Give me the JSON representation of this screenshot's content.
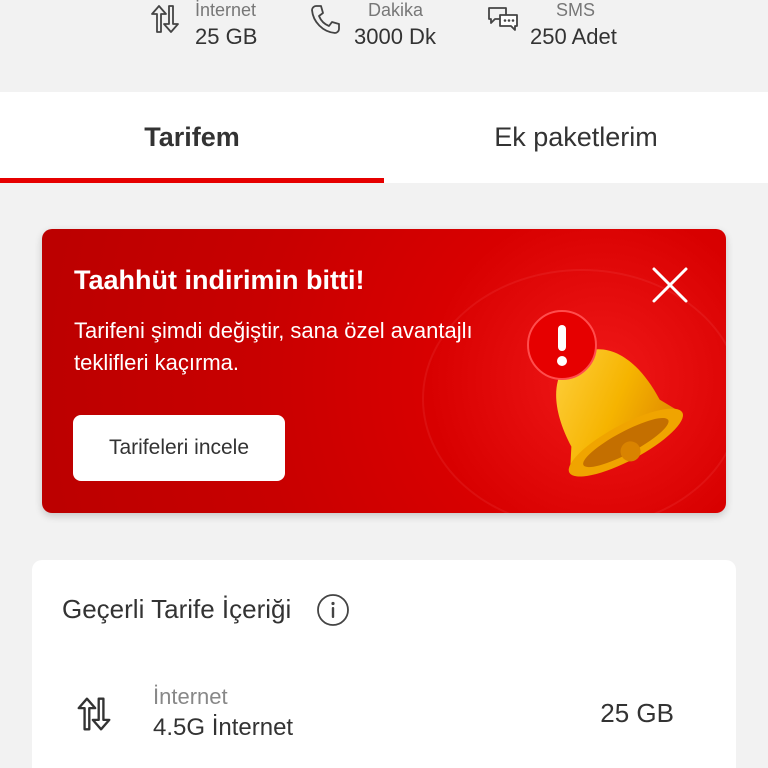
{
  "summary": {
    "internet": {
      "icon": "data-transfer-icon",
      "label": "İnternet",
      "value": "25 GB"
    },
    "minutes": {
      "icon": "phone-icon",
      "label": "Dakika",
      "value": "3000 Dk"
    },
    "sms": {
      "icon": "chat-bubbles-icon",
      "label": "SMS",
      "value": "250 Adet"
    }
  },
  "tabs": [
    {
      "label": "Tarifem",
      "active": true
    },
    {
      "label": "Ek paketlerim",
      "active": false
    }
  ],
  "banner": {
    "title": "Taahhüt indirimin bitti!",
    "text": "Tarifeni şimdi değiştir, sana özel avantajlı teklifleri kaçırma.",
    "button_label": "Tarifeleri incele",
    "close_icon": "close-icon",
    "image": "bell-alert-icon",
    "colors": {
      "background": "#d80000",
      "bell": "#f7b500",
      "alert": "#e60000"
    }
  },
  "tariff_card": {
    "title": "Geçerli Tarife İçeriği",
    "info_icon": "info-icon",
    "items": [
      {
        "icon": "data-transfer-icon",
        "label": "İnternet",
        "subtitle": "4.5G İnternet",
        "value": "25 GB"
      }
    ]
  },
  "colors": {
    "accent": "#e60000",
    "page_bg": "#f2f2f2",
    "card_bg": "#ffffff"
  }
}
